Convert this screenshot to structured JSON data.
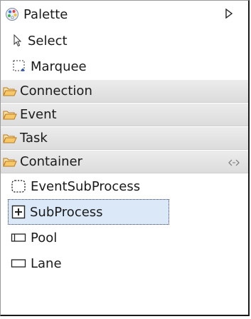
{
  "palette": {
    "title": "Palette",
    "tools": [
      {
        "label": "Select",
        "icon": "arrow-select-icon"
      },
      {
        "label": "Marquee",
        "icon": "marquee-icon"
      }
    ],
    "drawers": [
      {
        "label": "Connection",
        "icon": "folder-open-icon"
      },
      {
        "label": "Event",
        "icon": "folder-open-icon"
      },
      {
        "label": "Task",
        "icon": "folder-open-icon"
      },
      {
        "label": "Container",
        "icon": "folder-open-icon"
      }
    ],
    "container_items": [
      {
        "label": "EventSubProcess",
        "icon": "event-subprocess-icon"
      },
      {
        "label": "SubProcess",
        "icon": "subprocess-icon",
        "selected": true
      },
      {
        "label": "Pool",
        "icon": "pool-icon"
      },
      {
        "label": "Lane",
        "icon": "lane-icon"
      }
    ],
    "colors": {
      "selection_bg": "#dbe8f8",
      "folder": "#e8a23a",
      "drawer_bg": "#e4e4e4"
    }
  }
}
